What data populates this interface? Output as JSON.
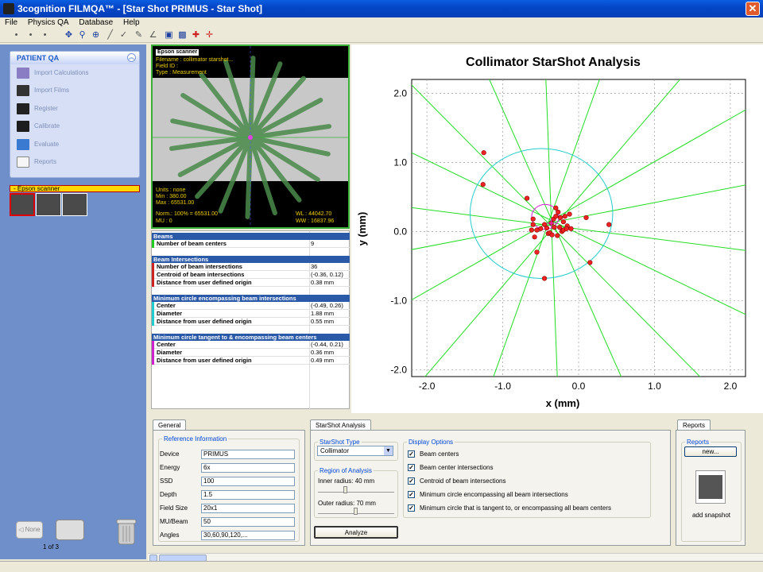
{
  "window": {
    "title": "3cognition FILMQA™ - [Star Shot PRIMUS - Star Shot]"
  },
  "menu": [
    "File",
    "Physics QA",
    "Database",
    "Help"
  ],
  "left": {
    "section_title": "PATIENT QA",
    "items": [
      "Import Calculations",
      "Import Films",
      "Register",
      "Calibrate",
      "Evaluate",
      "Reports"
    ],
    "thumb_group_label": "Epson scanner",
    "nav_none": "None",
    "page_count": "1 of 3"
  },
  "film": {
    "scanner": "Epson scanner",
    "filename": "Filename : collimator starshot...",
    "field_id": "Field ID :",
    "type": "Type    : Measurement",
    "units": "Units : none",
    "min": "Min   : 380.00",
    "max": "Max   : 65531.00",
    "norm": "Norm.: 100% = 65531.00",
    "mu": "MU    : 0",
    "wl": "WL : 44042.70",
    "ww": "WW : 16837.96"
  },
  "results": {
    "beams": {
      "header": "Beams",
      "rows": [
        {
          "k": "Number of beam centers",
          "v": "9"
        }
      ]
    },
    "intersections": {
      "header": "Beam Intersections",
      "rows": [
        {
          "k": "Number of beam intersections",
          "v": "36"
        },
        {
          "k": "Centroid of beam intersections",
          "v": "(-0.36, 0.12)"
        },
        {
          "k": "Distance from user defined origin",
          "v": "0.38 mm"
        }
      ]
    },
    "min_circle": {
      "header": "Minimum circle encompassing beam intersections",
      "rows": [
        {
          "k": "Center",
          "v": "(-0.49, 0.26)"
        },
        {
          "k": "Diameter",
          "v": "1.88 mm"
        },
        {
          "k": "Distance from user defined origin",
          "v": "0.55 mm"
        }
      ]
    },
    "tangent_circle": {
      "header": "Minimum circle tangent to & encompassing beam centers",
      "rows": [
        {
          "k": "Center",
          "v": "(-0.44, 0.21)"
        },
        {
          "k": "Diameter",
          "v": "0.36 mm"
        },
        {
          "k": "Distance from user defined origin",
          "v": "0.49 mm"
        }
      ]
    },
    "colors": {
      "beams": "#22cc22",
      "intersections": "#cc2222",
      "min_circle": "#22cccc",
      "tangent_circle": "#cc22cc"
    }
  },
  "chart_data": {
    "type": "scatter",
    "title": "Collimator StarShot Analysis",
    "xlabel": "x (mm)",
    "ylabel": "y (mm)",
    "xlim": [
      -2.2,
      2.2
    ],
    "ylim": [
      -2.1,
      2.2
    ],
    "xticks": [
      -2.0,
      -1.0,
      0.0,
      1.0,
      2.0
    ],
    "yticks": [
      -2.0,
      -1.0,
      0.0,
      1.0,
      2.0
    ],
    "grid": true,
    "beam_angles_deg": [
      12,
      32,
      52,
      72,
      92,
      112,
      132,
      152,
      172
    ],
    "beam_center_point": [
      -0.36,
      0.12
    ],
    "min_circle": {
      "center": [
        -0.49,
        0.26
      ],
      "diameter": 1.88
    },
    "tangent_circle": {
      "center": [
        -0.44,
        0.21
      ],
      "diameter": 0.36
    },
    "intersections": [
      [
        -1.25,
        1.14
      ],
      [
        -1.26,
        0.68
      ],
      [
        -0.68,
        0.48
      ],
      [
        -0.6,
        0.18
      ],
      [
        -0.6,
        0.1
      ],
      [
        -0.58,
        -0.08
      ],
      [
        -0.55,
        -0.3
      ],
      [
        -0.45,
        -0.68
      ],
      [
        -0.42,
        0.05
      ],
      [
        -0.4,
        -0.03
      ],
      [
        -0.36,
        0.12
      ],
      [
        -0.33,
        0.18
      ],
      [
        -0.3,
        0.34
      ],
      [
        -0.27,
        0.28
      ],
      [
        -0.25,
        0.06
      ],
      [
        -0.22,
        0.0
      ],
      [
        -0.2,
        0.02
      ],
      [
        -0.18,
        0.22
      ],
      [
        -0.15,
        0.08
      ],
      [
        -0.12,
        0.25
      ],
      [
        -0.38,
        -0.02
      ],
      [
        -0.5,
        0.04
      ],
      [
        -0.55,
        0.02
      ],
      [
        0.1,
        0.2
      ],
      [
        0.4,
        0.1
      ],
      [
        0.15,
        -0.45
      ],
      [
        -0.28,
        -0.06
      ],
      [
        -0.3,
        0.22
      ],
      [
        -0.45,
        0.1
      ],
      [
        -0.1,
        0.04
      ],
      [
        -0.2,
        0.14
      ],
      [
        -0.35,
        -0.05
      ],
      [
        -0.24,
        0.2
      ],
      [
        -0.62,
        0.02
      ],
      [
        -0.32,
        0.06
      ],
      [
        -0.16,
        0.04
      ]
    ]
  },
  "bottom": {
    "general_tab": "General",
    "ref_legend": "Reference Information",
    "fields": [
      {
        "label": "Device",
        "value": "PRIMUS"
      },
      {
        "label": "Energy",
        "value": "6x"
      },
      {
        "label": "SSD",
        "value": "100"
      },
      {
        "label": "Depth",
        "value": "1.5"
      },
      {
        "label": "Field Size",
        "value": "20x1"
      },
      {
        "label": "MU/Beam",
        "value": "50"
      },
      {
        "label": "Angles",
        "value": "30,60,90,120,..."
      }
    ],
    "starshot_tab": "StarShot Analysis",
    "type_legend": "StarShot Type",
    "type_value": "Collimator",
    "roi_legend": "Region of Analysis",
    "inner_label": "Inner radius: 40 mm",
    "inner_level": 0.35,
    "outer_label": "Outer radius: 70 mm",
    "outer_level": 0.5,
    "analyze": "Analyze",
    "display_legend": "Display Options",
    "options": [
      "Beam centers",
      "Beam center intersections",
      "Centroid of beam intersections",
      "Minimum circle encompassing all beam intersections",
      "Minimum circle that is tangent to, or encompassing all beam centers"
    ],
    "reports_tab": "Reports",
    "reports_legend": "Reports",
    "new_btn": "new...",
    "snapshot_label": "add snapshot"
  }
}
